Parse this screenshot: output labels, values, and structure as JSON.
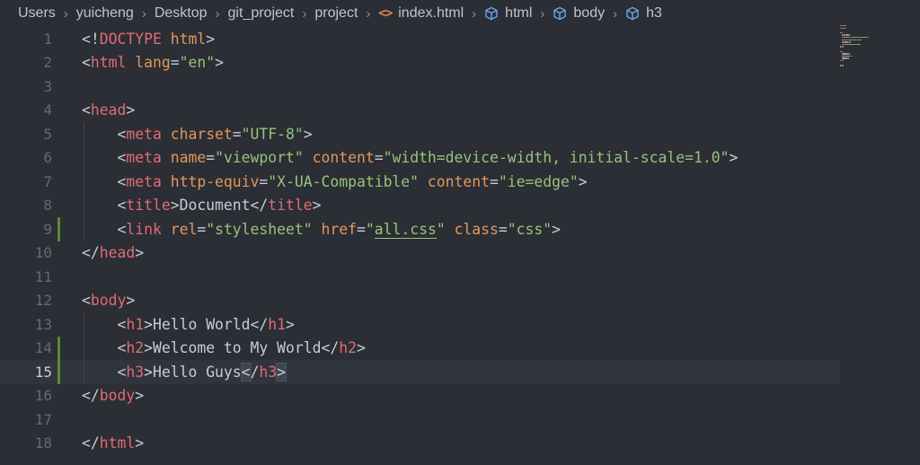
{
  "breadcrumb": {
    "items": [
      "Users",
      "yuicheng",
      "Desktop",
      "git_project",
      "project"
    ],
    "file": "index.html",
    "symbols": [
      "html",
      "body",
      "h3"
    ]
  },
  "editor": {
    "current_line": 15,
    "modified_lines": [
      9,
      14,
      15
    ],
    "lines": [
      {
        "n": "1",
        "indent": 0,
        "tokens": [
          [
            "p",
            "<!"
          ],
          [
            "kw",
            "DOCTYPE"
          ],
          [
            "p",
            " "
          ],
          [
            "a",
            "html"
          ],
          [
            "p",
            ">"
          ]
        ]
      },
      {
        "n": "2",
        "indent": 0,
        "tokens": [
          [
            "p",
            "<"
          ],
          [
            "t",
            "html"
          ],
          [
            "p",
            " "
          ],
          [
            "a",
            "lang"
          ],
          [
            "p",
            "="
          ],
          [
            "s",
            "\"en\""
          ],
          [
            "p",
            ">"
          ]
        ]
      },
      {
        "n": "3",
        "indent": 0,
        "tokens": []
      },
      {
        "n": "4",
        "indent": 0,
        "tokens": [
          [
            "p",
            "<"
          ],
          [
            "t",
            "head"
          ],
          [
            "p",
            ">"
          ]
        ]
      },
      {
        "n": "5",
        "indent": 1,
        "tokens": [
          [
            "p",
            "<"
          ],
          [
            "t",
            "meta"
          ],
          [
            "p",
            " "
          ],
          [
            "a",
            "charset"
          ],
          [
            "p",
            "="
          ],
          [
            "s",
            "\"UTF-8\""
          ],
          [
            "p",
            ">"
          ]
        ]
      },
      {
        "n": "6",
        "indent": 1,
        "tokens": [
          [
            "p",
            "<"
          ],
          [
            "t",
            "meta"
          ],
          [
            "p",
            " "
          ],
          [
            "a",
            "name"
          ],
          [
            "p",
            "="
          ],
          [
            "s",
            "\"viewport\""
          ],
          [
            "p",
            " "
          ],
          [
            "a",
            "content"
          ],
          [
            "p",
            "="
          ],
          [
            "s",
            "\"width=device-width, initial-scale=1.0\""
          ],
          [
            "p",
            ">"
          ]
        ]
      },
      {
        "n": "7",
        "indent": 1,
        "tokens": [
          [
            "p",
            "<"
          ],
          [
            "t",
            "meta"
          ],
          [
            "p",
            " "
          ],
          [
            "a",
            "http-equiv"
          ],
          [
            "p",
            "="
          ],
          [
            "s",
            "\"X-UA-Compatible\""
          ],
          [
            "p",
            " "
          ],
          [
            "a",
            "content"
          ],
          [
            "p",
            "="
          ],
          [
            "s",
            "\"ie=edge\""
          ],
          [
            "p",
            ">"
          ]
        ]
      },
      {
        "n": "8",
        "indent": 1,
        "tokens": [
          [
            "p",
            "<"
          ],
          [
            "t",
            "title"
          ],
          [
            "p",
            ">"
          ],
          [
            "x",
            "Document"
          ],
          [
            "p",
            "</"
          ],
          [
            "t",
            "title"
          ],
          [
            "p",
            ">"
          ]
        ]
      },
      {
        "n": "9",
        "indent": 1,
        "tokens": [
          [
            "p",
            "<"
          ],
          [
            "t",
            "link"
          ],
          [
            "p",
            " "
          ],
          [
            "a",
            "rel"
          ],
          [
            "p",
            "="
          ],
          [
            "s",
            "\"stylesheet\""
          ],
          [
            "p",
            " "
          ],
          [
            "a",
            "href"
          ],
          [
            "p",
            "="
          ],
          [
            "s",
            "\""
          ],
          [
            "s ul",
            "all.css"
          ],
          [
            "s",
            "\""
          ],
          [
            "p",
            " "
          ],
          [
            "a",
            "class"
          ],
          [
            "p",
            "="
          ],
          [
            "s",
            "\"css\""
          ],
          [
            "p",
            ">"
          ]
        ]
      },
      {
        "n": "10",
        "indent": 0,
        "tokens": [
          [
            "p",
            "</"
          ],
          [
            "t",
            "head"
          ],
          [
            "p",
            ">"
          ]
        ]
      },
      {
        "n": "11",
        "indent": 0,
        "tokens": []
      },
      {
        "n": "12",
        "indent": 0,
        "tokens": [
          [
            "p",
            "<"
          ],
          [
            "t",
            "body"
          ],
          [
            "p",
            ">"
          ]
        ]
      },
      {
        "n": "13",
        "indent": 1,
        "tokens": [
          [
            "p",
            "<"
          ],
          [
            "t",
            "h1"
          ],
          [
            "p",
            ">"
          ],
          [
            "x",
            "Hello World"
          ],
          [
            "p",
            "</"
          ],
          [
            "t",
            "h1"
          ],
          [
            "p",
            ">"
          ]
        ]
      },
      {
        "n": "14",
        "indent": 1,
        "tokens": [
          [
            "p",
            "<"
          ],
          [
            "t",
            "h2"
          ],
          [
            "p",
            ">"
          ],
          [
            "x",
            "Welcome to My World"
          ],
          [
            "p",
            "</"
          ],
          [
            "t",
            "h2"
          ],
          [
            "p",
            ">"
          ]
        ]
      },
      {
        "n": "15",
        "indent": 1,
        "tokens": [
          [
            "p",
            "<"
          ],
          [
            "t",
            "h3"
          ],
          [
            "p",
            ">"
          ],
          [
            "x",
            "Hello Guys"
          ],
          [
            "p bm",
            "<"
          ],
          [
            "p",
            "/"
          ],
          [
            "t",
            "h3"
          ],
          [
            "p bm",
            ">"
          ]
        ]
      },
      {
        "n": "16",
        "indent": 0,
        "tokens": [
          [
            "p",
            "</"
          ],
          [
            "t",
            "body"
          ],
          [
            "p",
            ">"
          ]
        ]
      },
      {
        "n": "17",
        "indent": 0,
        "tokens": []
      },
      {
        "n": "18",
        "indent": 0,
        "tokens": [
          [
            "p",
            "</"
          ],
          [
            "t",
            "html"
          ],
          [
            "p",
            ">"
          ]
        ]
      }
    ]
  },
  "colors": {
    "background": "#2b2e35",
    "tag": "#e06c75",
    "attribute": "#e2975d",
    "string": "#98c379",
    "text": "#c8ccd4",
    "line_number": "#656a74",
    "modified_marker": "#5e8a34"
  }
}
